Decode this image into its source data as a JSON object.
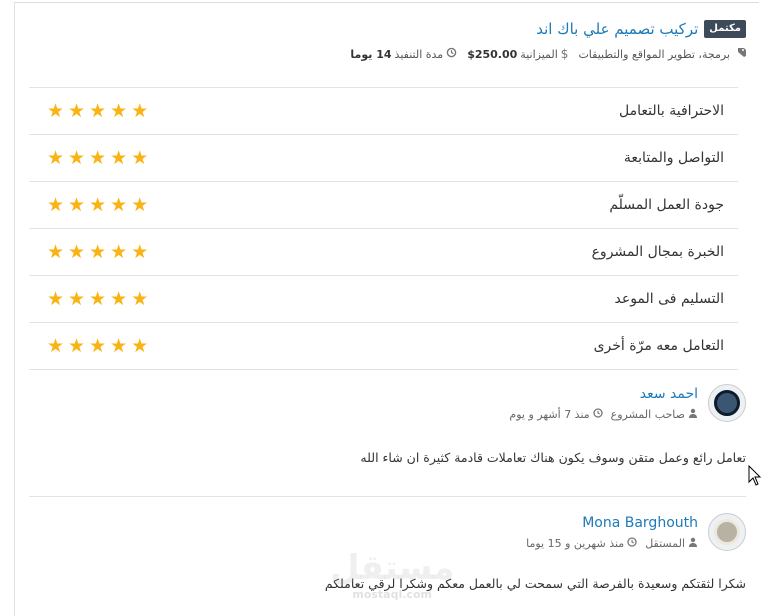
{
  "project": {
    "status_badge": "مكتمل",
    "title": "تركيب تصميم علي باك اند",
    "category": "برمجة، تطوير المواقع والتطبيقات",
    "budget_label": "الميزانية",
    "budget_value": "$250.00",
    "duration_label": "مدة التنفيذ",
    "duration_value": "14 يوما",
    "icons": {
      "tags": "tags-icon",
      "budget": "dollar-icon",
      "duration": "history-icon"
    }
  },
  "ratings": {
    "star_color": "#f9b413",
    "items": [
      {
        "label": "الاحترافية بالتعامل",
        "stars": 5
      },
      {
        "label": "التواصل والمتابعة",
        "stars": 5
      },
      {
        "label": "جودة العمل المسلّم",
        "stars": 5
      },
      {
        "label": "الخبرة بمجال المشروع",
        "stars": 5
      },
      {
        "label": "التسليم فى الموعد",
        "stars": 5
      },
      {
        "label": "التعامل معه مرّة أخرى",
        "stars": 5
      }
    ]
  },
  "comments": [
    {
      "name": "احمد سعد",
      "role": "صاحب المشروع",
      "time": "منذ 7 أشهر و يوم",
      "text": "تعامل رائع وعمل متقن وسوف يكون هناك تعاملات قادمة كثيرة ان شاء الله"
    },
    {
      "name": "Mona Barghouth",
      "role": "المستقل",
      "time": "منذ شهرين و 15 يوما",
      "text": "شكرا لثقتكم وسعيدة بالفرصة التي سمحت لي بالعمل معكم وشكرا لرقي تعاملكم"
    }
  ],
  "watermark": {
    "text": "مستقل",
    "sub": "mostaql.com"
  },
  "colors": {
    "accent": "#1d7ab8",
    "badge_bg": "#3d4a5a"
  }
}
